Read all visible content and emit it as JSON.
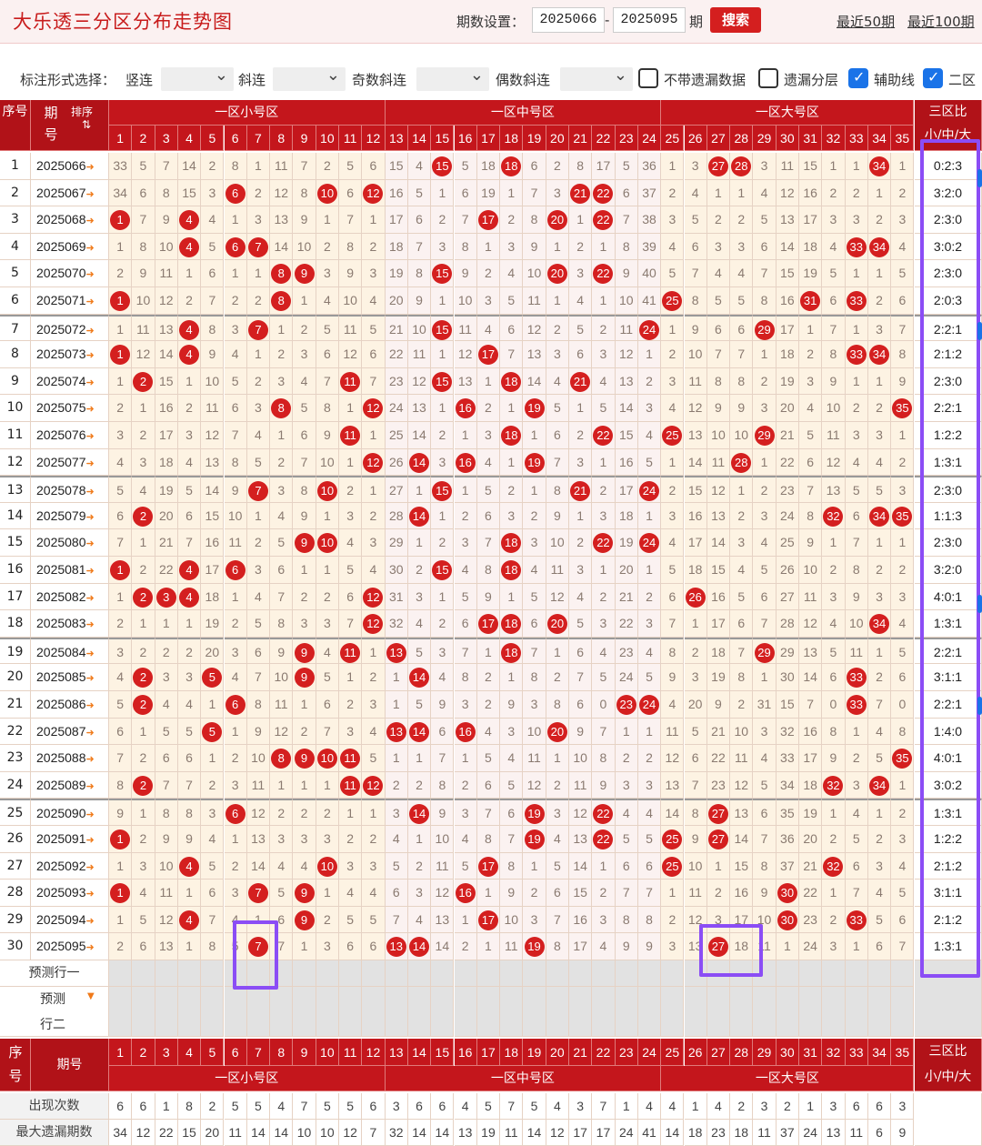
{
  "app": {
    "title": "大乐透三分区分布走势图"
  },
  "period": {
    "label": "期数设置：",
    "start": "2025066",
    "dash": "-",
    "end": "2025095",
    "unit": "期",
    "search_label": "搜索",
    "recent50": "最近50期",
    "recent100": "最近100期"
  },
  "options": {
    "mark_label": "标注形式选择：",
    "vertical": "竖连",
    "diagonal": "斜连",
    "odd_diag": "奇数斜连",
    "even_diag": "偶数斜连",
    "no_missing": "不带遗漏数据",
    "missing_layer": "遗漏分层",
    "aux_line": "辅助线",
    "zone2_prefix": "二区"
  },
  "header": {
    "seq": "序号",
    "issue": "期号",
    "sort": "排序",
    "zone_small": "一区小号区",
    "zone_mid": "一区中号区",
    "zone_big": "一区大号区",
    "ratio": "三区比",
    "ratio_sub": "小/中/大"
  },
  "numbers": [
    "1",
    "2",
    "3",
    "4",
    "5",
    "6",
    "7",
    "8",
    "9",
    "10",
    "11",
    "12",
    "13",
    "14",
    "15",
    "16",
    "17",
    "18",
    "19",
    "20",
    "21",
    "22",
    "23",
    "24",
    "25",
    "26",
    "27",
    "28",
    "29",
    "30",
    "31",
    "32",
    "33",
    "34",
    "35"
  ],
  "rows": [
    {
      "idx": "1",
      "issue": "2025066",
      "ratio": "0:2:3",
      "hits": [
        15,
        18,
        27,
        28,
        34
      ],
      "miss": [
        33,
        5,
        7,
        14,
        2,
        8,
        1,
        11,
        7,
        2,
        5,
        6,
        15,
        4,
        0,
        5,
        18,
        0,
        6,
        2,
        8,
        17,
        5,
        36,
        1,
        3,
        0,
        0,
        3,
        11,
        15,
        1,
        1,
        0,
        1
      ]
    },
    {
      "idx": "2",
      "issue": "2025067",
      "ratio": "3:2:0",
      "hits": [
        6,
        10,
        12,
        21,
        22
      ],
      "miss": [
        34,
        6,
        8,
        15,
        3,
        0,
        2,
        12,
        8,
        0,
        6,
        0,
        16,
        5,
        1,
        6,
        19,
        1,
        7,
        3,
        0,
        0,
        6,
        37,
        2,
        4,
        1,
        1,
        4,
        12,
        16,
        2,
        2,
        1,
        2
      ]
    },
    {
      "idx": "3",
      "issue": "2025068",
      "ratio": "2:3:0",
      "hits": [
        1,
        4,
        17,
        20,
        22
      ],
      "miss": [
        0,
        7,
        9,
        0,
        4,
        1,
        3,
        13,
        9,
        1,
        7,
        1,
        17,
        6,
        2,
        7,
        0,
        2,
        8,
        0,
        1,
        0,
        7,
        38,
        3,
        5,
        2,
        2,
        5,
        13,
        17,
        3,
        3,
        2,
        3
      ]
    },
    {
      "idx": "4",
      "issue": "2025069",
      "ratio": "3:0:2",
      "hits": [
        4,
        6,
        7,
        33,
        34
      ],
      "miss": [
        1,
        8,
        10,
        0,
        5,
        0,
        0,
        14,
        10,
        2,
        8,
        2,
        18,
        7,
        3,
        8,
        1,
        3,
        9,
        1,
        2,
        1,
        8,
        39,
        4,
        6,
        3,
        3,
        6,
        14,
        18,
        4,
        0,
        0,
        4
      ]
    },
    {
      "idx": "5",
      "issue": "2025070",
      "ratio": "2:3:0",
      "hits": [
        8,
        9,
        15,
        20,
        22
      ],
      "miss": [
        2,
        9,
        11,
        1,
        6,
        1,
        1,
        0,
        0,
        3,
        9,
        3,
        19,
        8,
        0,
        9,
        2,
        4,
        10,
        0,
        3,
        0,
        9,
        40,
        5,
        7,
        4,
        4,
        7,
        15,
        19,
        5,
        1,
        1,
        5
      ]
    },
    {
      "idx": "6",
      "issue": "2025071",
      "ratio": "2:0:3",
      "hits": [
        1,
        8,
        25,
        31,
        33
      ],
      "miss": [
        0,
        10,
        12,
        2,
        7,
        2,
        2,
        0,
        1,
        4,
        10,
        4,
        20,
        9,
        1,
        10,
        3,
        5,
        11,
        1,
        4,
        1,
        10,
        41,
        0,
        8,
        5,
        5,
        8,
        16,
        0,
        6,
        0,
        2,
        6
      ]
    },
    {
      "idx": "7",
      "issue": "2025072",
      "ratio": "2:2:1",
      "hits": [
        4,
        7,
        15,
        24,
        29
      ],
      "miss": [
        1,
        11,
        13,
        0,
        8,
        3,
        0,
        1,
        2,
        5,
        11,
        5,
        21,
        10,
        0,
        11,
        4,
        6,
        12,
        2,
        5,
        2,
        11,
        0,
        1,
        9,
        6,
        6,
        0,
        17,
        1,
        7,
        1,
        3,
        7
      ]
    },
    {
      "idx": "8",
      "issue": "2025073",
      "ratio": "2:1:2",
      "hits": [
        1,
        4,
        17,
        33,
        34
      ],
      "miss": [
        0,
        12,
        14,
        0,
        9,
        4,
        1,
        2,
        3,
        6,
        12,
        6,
        22,
        11,
        1,
        12,
        0,
        7,
        13,
        3,
        6,
        3,
        12,
        1,
        2,
        10,
        7,
        7,
        1,
        18,
        2,
        8,
        0,
        0,
        8
      ]
    },
    {
      "idx": "9",
      "issue": "2025074",
      "ratio": "2:3:0",
      "hits": [
        2,
        11,
        15,
        18,
        21
      ],
      "miss": [
        1,
        0,
        15,
        1,
        10,
        5,
        2,
        3,
        4,
        7,
        0,
        7,
        23,
        12,
        0,
        13,
        1,
        0,
        14,
        4,
        0,
        4,
        13,
        2,
        3,
        11,
        8,
        8,
        2,
        19,
        3,
        9,
        1,
        1,
        9
      ]
    },
    {
      "idx": "10",
      "issue": "2025075",
      "ratio": "2:2:1",
      "hits": [
        8,
        12,
        16,
        19,
        35
      ],
      "miss": [
        2,
        1,
        16,
        2,
        11,
        6,
        3,
        0,
        5,
        8,
        1,
        0,
        24,
        13,
        1,
        0,
        2,
        1,
        0,
        5,
        1,
        5,
        14,
        3,
        4,
        12,
        9,
        9,
        3,
        20,
        4,
        10,
        2,
        2,
        0
      ]
    },
    {
      "idx": "11",
      "issue": "2025076",
      "ratio": "1:2:2",
      "hits": [
        11,
        18,
        22,
        25,
        29
      ],
      "miss": [
        3,
        2,
        17,
        3,
        12,
        7,
        4,
        1,
        6,
        9,
        0,
        1,
        25,
        14,
        2,
        1,
        3,
        0,
        1,
        6,
        2,
        0,
        15,
        4,
        0,
        13,
        10,
        10,
        0,
        21,
        5,
        11,
        3,
        3,
        1
      ]
    },
    {
      "idx": "12",
      "issue": "2025077",
      "ratio": "1:3:1",
      "hits": [
        12,
        14,
        16,
        19,
        28
      ],
      "miss": [
        4,
        3,
        18,
        4,
        13,
        8,
        5,
        2,
        7,
        10,
        1,
        0,
        26,
        0,
        3,
        0,
        4,
        1,
        0,
        7,
        3,
        1,
        16,
        5,
        1,
        14,
        11,
        0,
        1,
        22,
        6,
        12,
        4,
        4,
        2
      ]
    },
    {
      "idx": "13",
      "issue": "2025078",
      "ratio": "2:3:0",
      "hits": [
        7,
        10,
        15,
        21,
        24
      ],
      "miss": [
        5,
        4,
        19,
        5,
        14,
        9,
        0,
        3,
        8,
        0,
        2,
        1,
        27,
        1,
        0,
        1,
        5,
        2,
        1,
        8,
        0,
        2,
        17,
        0,
        2,
        15,
        12,
        1,
        2,
        23,
        7,
        13,
        5,
        5,
        3
      ]
    },
    {
      "idx": "14",
      "issue": "2025079",
      "ratio": "1:1:3",
      "hits": [
        2,
        14,
        32,
        34,
        35
      ],
      "miss": [
        6,
        0,
        20,
        6,
        15,
        10,
        1,
        4,
        9,
        1,
        3,
        2,
        28,
        0,
        1,
        2,
        6,
        3,
        2,
        9,
        1,
        3,
        18,
        1,
        3,
        16,
        13,
        2,
        3,
        24,
        8,
        0,
        6,
        0,
        0
      ]
    },
    {
      "idx": "15",
      "issue": "2025080",
      "ratio": "2:3:0",
      "hits": [
        9,
        10,
        18,
        22,
        24
      ],
      "miss": [
        7,
        1,
        21,
        7,
        16,
        11,
        2,
        5,
        0,
        0,
        4,
        3,
        29,
        1,
        2,
        3,
        7,
        0,
        3,
        10,
        2,
        0,
        19,
        0,
        4,
        17,
        14,
        3,
        4,
        25,
        9,
        1,
        7,
        1,
        1
      ]
    },
    {
      "idx": "16",
      "issue": "2025081",
      "ratio": "3:2:0",
      "hits": [
        1,
        4,
        6,
        15,
        18
      ],
      "miss": [
        0,
        2,
        22,
        0,
        17,
        0,
        3,
        6,
        1,
        1,
        5,
        4,
        30,
        2,
        0,
        4,
        8,
        0,
        4,
        11,
        3,
        1,
        20,
        1,
        5,
        18,
        15,
        4,
        5,
        26,
        10,
        2,
        8,
        2,
        2
      ]
    },
    {
      "idx": "17",
      "issue": "2025082",
      "ratio": "4:0:1",
      "hits": [
        2,
        3,
        4,
        12,
        26
      ],
      "miss": [
        1,
        0,
        0,
        0,
        18,
        1,
        4,
        7,
        2,
        2,
        6,
        0,
        31,
        3,
        1,
        5,
        9,
        1,
        5,
        12,
        4,
        2,
        21,
        2,
        6,
        0,
        16,
        5,
        6,
        27,
        11,
        3,
        9,
        3,
        3
      ]
    },
    {
      "idx": "18",
      "issue": "2025083",
      "ratio": "1:3:1",
      "hits": [
        12,
        17,
        18,
        20,
        34
      ],
      "miss": [
        2,
        1,
        1,
        1,
        19,
        2,
        5,
        8,
        3,
        3,
        7,
        0,
        32,
        4,
        2,
        6,
        0,
        0,
        6,
        0,
        5,
        3,
        22,
        3,
        7,
        1,
        17,
        6,
        7,
        28,
        12,
        4,
        10,
        0,
        4
      ]
    },
    {
      "idx": "19",
      "issue": "2025084",
      "ratio": "2:2:1",
      "hits": [
        9,
        11,
        13,
        18,
        29
      ],
      "miss": [
        3,
        2,
        2,
        2,
        20,
        3,
        6,
        9,
        0,
        4,
        0,
        1,
        0,
        5,
        3,
        7,
        1,
        0,
        7,
        1,
        6,
        4,
        23,
        4,
        8,
        2,
        18,
        7,
        0,
        29,
        13,
        5,
        11,
        1,
        5
      ]
    },
    {
      "idx": "20",
      "issue": "2025085",
      "ratio": "3:1:1",
      "hits": [
        2,
        5,
        9,
        14,
        33
      ],
      "miss": [
        4,
        0,
        3,
        3,
        0,
        4,
        7,
        10,
        0,
        5,
        1,
        2,
        1,
        0,
        4,
        8,
        2,
        1,
        8,
        2,
        7,
        5,
        24,
        5,
        9,
        3,
        19,
        8,
        1,
        30,
        14,
        6,
        0,
        2,
        6
      ]
    },
    {
      "idx": "21",
      "issue": "2025086",
      "ratio": "2:2:1",
      "hits": [
        2,
        6,
        23,
        24,
        33
      ],
      "miss": [
        5,
        0,
        4,
        4,
        1,
        0,
        8,
        11,
        1,
        6,
        2,
        3,
        1,
        5,
        9,
        3,
        2,
        9,
        3,
        8,
        6,
        0,
        0,
        10,
        4,
        20,
        9,
        2,
        31,
        15,
        7,
        0,
        3,
        7,
        0
      ]
    },
    {
      "idx": "22",
      "issue": "2025087",
      "ratio": "1:4:0",
      "hits": [
        5,
        13,
        14,
        16,
        20
      ],
      "miss": [
        6,
        1,
        5,
        5,
        0,
        1,
        9,
        12,
        2,
        7,
        3,
        4,
        0,
        0,
        6,
        0,
        4,
        3,
        10,
        0,
        9,
        7,
        1,
        1,
        11,
        5,
        21,
        10,
        3,
        32,
        16,
        8,
        1,
        4,
        8
      ]
    },
    {
      "idx": "23",
      "issue": "2025088",
      "ratio": "4:0:1",
      "hits": [
        8,
        9,
        10,
        11,
        35
      ],
      "miss": [
        7,
        2,
        6,
        6,
        1,
        2,
        10,
        0,
        0,
        0,
        0,
        5,
        1,
        1,
        7,
        1,
        5,
        4,
        11,
        1,
        10,
        8,
        2,
        2,
        12,
        6,
        22,
        11,
        4,
        33,
        17,
        9,
        2,
        5,
        0
      ]
    },
    {
      "idx": "24",
      "issue": "2025089",
      "ratio": "3:0:2",
      "hits": [
        2,
        11,
        12,
        32,
        34
      ],
      "miss": [
        8,
        0,
        7,
        7,
        2,
        3,
        11,
        1,
        1,
        1,
        0,
        0,
        2,
        2,
        8,
        2,
        6,
        5,
        12,
        2,
        11,
        9,
        3,
        3,
        13,
        7,
        23,
        12,
        5,
        34,
        18,
        0,
        3,
        0,
        1
      ]
    },
    {
      "idx": "25",
      "issue": "2025090",
      "ratio": "1:3:1",
      "hits": [
        6,
        14,
        19,
        22,
        27
      ],
      "miss": [
        9,
        1,
        8,
        8,
        3,
        0,
        12,
        2,
        2,
        2,
        1,
        1,
        3,
        0,
        9,
        3,
        7,
        6,
        0,
        3,
        12,
        0,
        4,
        4,
        14,
        8,
        0,
        13,
        6,
        35,
        19,
        1,
        4,
        1,
        2
      ]
    },
    {
      "idx": "26",
      "issue": "2025091",
      "ratio": "1:2:2",
      "hits": [
        1,
        19,
        22,
        25,
        27
      ],
      "miss": [
        0,
        2,
        9,
        9,
        4,
        1,
        13,
        3,
        3,
        3,
        2,
        2,
        4,
        1,
        10,
        4,
        8,
        7,
        0,
        4,
        13,
        0,
        5,
        5,
        0,
        9,
        0,
        14,
        7,
        36,
        20,
        2,
        5,
        2,
        3
      ]
    },
    {
      "idx": "27",
      "issue": "2025092",
      "ratio": "2:1:2",
      "hits": [
        4,
        10,
        17,
        25,
        32
      ],
      "miss": [
        1,
        3,
        10,
        0,
        5,
        2,
        14,
        4,
        4,
        0,
        3,
        3,
        5,
        2,
        11,
        5,
        0,
        8,
        1,
        5,
        14,
        1,
        6,
        6,
        0,
        10,
        1,
        15,
        8,
        37,
        21,
        0,
        6,
        3,
        4
      ]
    },
    {
      "idx": "28",
      "issue": "2025093",
      "ratio": "3:1:1",
      "hits": [
        1,
        7,
        9,
        16,
        30
      ],
      "miss": [
        0,
        4,
        11,
        1,
        6,
        3,
        0,
        5,
        0,
        1,
        4,
        4,
        6,
        3,
        12,
        0,
        1,
        9,
        2,
        6,
        15,
        2,
        7,
        7,
        1,
        11,
        2,
        16,
        9,
        0,
        22,
        1,
        7,
        4,
        5
      ]
    },
    {
      "idx": "29",
      "issue": "2025094",
      "ratio": "2:1:2",
      "hits": [
        4,
        9,
        17,
        30,
        33
      ],
      "miss": [
        1,
        5,
        12,
        0,
        7,
        4,
        1,
        6,
        0,
        2,
        5,
        5,
        7,
        4,
        13,
        1,
        0,
        10,
        3,
        7,
        16,
        3,
        8,
        8,
        2,
        12,
        3,
        17,
        10,
        0,
        23,
        2,
        0,
        5,
        6
      ]
    },
    {
      "idx": "30",
      "issue": "2025095",
      "ratio": "1:3:1",
      "hits": [
        7,
        13,
        14,
        19,
        27
      ],
      "miss": [
        2,
        6,
        13,
        1,
        8,
        5,
        0,
        7,
        1,
        3,
        6,
        6,
        0,
        0,
        14,
        2,
        1,
        11,
        0,
        8,
        17,
        4,
        9,
        9,
        3,
        13,
        0,
        18,
        11,
        1,
        24,
        3,
        1,
        6,
        7
      ]
    }
  ],
  "pred": {
    "row1": "预测行一",
    "row2": "预测行二"
  },
  "footer": {
    "seq": "序号",
    "issue": "期号",
    "zone_small": "一区小号区",
    "zone_mid": "一区中号区",
    "zone_big": "一区大号区",
    "ratio": "三区比",
    "ratio_sub": "小/中/大",
    "appear_label": "出现次数",
    "appear": [
      6,
      6,
      1,
      8,
      2,
      5,
      5,
      4,
      7,
      5,
      5,
      6,
      3,
      6,
      6,
      4,
      5,
      7,
      5,
      4,
      3,
      7,
      1,
      4,
      4,
      1,
      4,
      2,
      3,
      2,
      1,
      3,
      6,
      6,
      3
    ],
    "maxmiss_label": "最大遗漏期数",
    "maxmiss": [
      34,
      12,
      22,
      15,
      20,
      11,
      14,
      14,
      10,
      10,
      12,
      7,
      32,
      14,
      14,
      13,
      19,
      11,
      14,
      12,
      17,
      17,
      24,
      41,
      14,
      18,
      23,
      18,
      11,
      37,
      24,
      13,
      11,
      6,
      9
    ]
  },
  "colors": {
    "brand_red": "#c4161c",
    "ball_red": "#d41f1f",
    "highlight_purple": "#8b4df5"
  }
}
